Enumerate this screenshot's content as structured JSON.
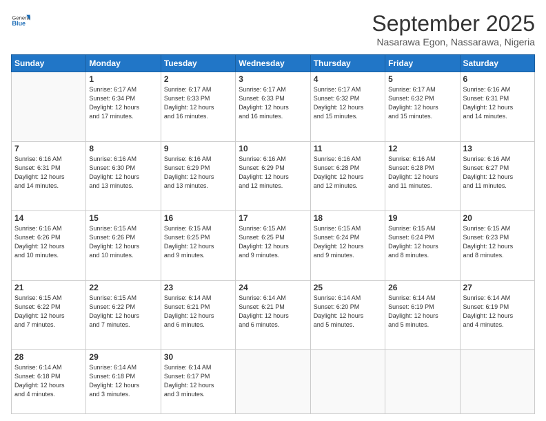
{
  "header": {
    "logo_general": "General",
    "logo_blue": "Blue",
    "month_title": "September 2025",
    "subtitle": "Nasarawa Egon, Nassarawa, Nigeria"
  },
  "days_of_week": [
    "Sunday",
    "Monday",
    "Tuesday",
    "Wednesday",
    "Thursday",
    "Friday",
    "Saturday"
  ],
  "weeks": [
    [
      {
        "day": "",
        "info": ""
      },
      {
        "day": "1",
        "info": "Sunrise: 6:17 AM\nSunset: 6:34 PM\nDaylight: 12 hours\nand 17 minutes."
      },
      {
        "day": "2",
        "info": "Sunrise: 6:17 AM\nSunset: 6:33 PM\nDaylight: 12 hours\nand 16 minutes."
      },
      {
        "day": "3",
        "info": "Sunrise: 6:17 AM\nSunset: 6:33 PM\nDaylight: 12 hours\nand 16 minutes."
      },
      {
        "day": "4",
        "info": "Sunrise: 6:17 AM\nSunset: 6:32 PM\nDaylight: 12 hours\nand 15 minutes."
      },
      {
        "day": "5",
        "info": "Sunrise: 6:17 AM\nSunset: 6:32 PM\nDaylight: 12 hours\nand 15 minutes."
      },
      {
        "day": "6",
        "info": "Sunrise: 6:16 AM\nSunset: 6:31 PM\nDaylight: 12 hours\nand 14 minutes."
      }
    ],
    [
      {
        "day": "7",
        "info": "Sunrise: 6:16 AM\nSunset: 6:31 PM\nDaylight: 12 hours\nand 14 minutes."
      },
      {
        "day": "8",
        "info": "Sunrise: 6:16 AM\nSunset: 6:30 PM\nDaylight: 12 hours\nand 13 minutes."
      },
      {
        "day": "9",
        "info": "Sunrise: 6:16 AM\nSunset: 6:29 PM\nDaylight: 12 hours\nand 13 minutes."
      },
      {
        "day": "10",
        "info": "Sunrise: 6:16 AM\nSunset: 6:29 PM\nDaylight: 12 hours\nand 12 minutes."
      },
      {
        "day": "11",
        "info": "Sunrise: 6:16 AM\nSunset: 6:28 PM\nDaylight: 12 hours\nand 12 minutes."
      },
      {
        "day": "12",
        "info": "Sunrise: 6:16 AM\nSunset: 6:28 PM\nDaylight: 12 hours\nand 11 minutes."
      },
      {
        "day": "13",
        "info": "Sunrise: 6:16 AM\nSunset: 6:27 PM\nDaylight: 12 hours\nand 11 minutes."
      }
    ],
    [
      {
        "day": "14",
        "info": "Sunrise: 6:16 AM\nSunset: 6:26 PM\nDaylight: 12 hours\nand 10 minutes."
      },
      {
        "day": "15",
        "info": "Sunrise: 6:15 AM\nSunset: 6:26 PM\nDaylight: 12 hours\nand 10 minutes."
      },
      {
        "day": "16",
        "info": "Sunrise: 6:15 AM\nSunset: 6:25 PM\nDaylight: 12 hours\nand 9 minutes."
      },
      {
        "day": "17",
        "info": "Sunrise: 6:15 AM\nSunset: 6:25 PM\nDaylight: 12 hours\nand 9 minutes."
      },
      {
        "day": "18",
        "info": "Sunrise: 6:15 AM\nSunset: 6:24 PM\nDaylight: 12 hours\nand 9 minutes."
      },
      {
        "day": "19",
        "info": "Sunrise: 6:15 AM\nSunset: 6:24 PM\nDaylight: 12 hours\nand 8 minutes."
      },
      {
        "day": "20",
        "info": "Sunrise: 6:15 AM\nSunset: 6:23 PM\nDaylight: 12 hours\nand 8 minutes."
      }
    ],
    [
      {
        "day": "21",
        "info": "Sunrise: 6:15 AM\nSunset: 6:22 PM\nDaylight: 12 hours\nand 7 minutes."
      },
      {
        "day": "22",
        "info": "Sunrise: 6:15 AM\nSunset: 6:22 PM\nDaylight: 12 hours\nand 7 minutes."
      },
      {
        "day": "23",
        "info": "Sunrise: 6:14 AM\nSunset: 6:21 PM\nDaylight: 12 hours\nand 6 minutes."
      },
      {
        "day": "24",
        "info": "Sunrise: 6:14 AM\nSunset: 6:21 PM\nDaylight: 12 hours\nand 6 minutes."
      },
      {
        "day": "25",
        "info": "Sunrise: 6:14 AM\nSunset: 6:20 PM\nDaylight: 12 hours\nand 5 minutes."
      },
      {
        "day": "26",
        "info": "Sunrise: 6:14 AM\nSunset: 6:19 PM\nDaylight: 12 hours\nand 5 minutes."
      },
      {
        "day": "27",
        "info": "Sunrise: 6:14 AM\nSunset: 6:19 PM\nDaylight: 12 hours\nand 4 minutes."
      }
    ],
    [
      {
        "day": "28",
        "info": "Sunrise: 6:14 AM\nSunset: 6:18 PM\nDaylight: 12 hours\nand 4 minutes."
      },
      {
        "day": "29",
        "info": "Sunrise: 6:14 AM\nSunset: 6:18 PM\nDaylight: 12 hours\nand 3 minutes."
      },
      {
        "day": "30",
        "info": "Sunrise: 6:14 AM\nSunset: 6:17 PM\nDaylight: 12 hours\nand 3 minutes."
      },
      {
        "day": "",
        "info": ""
      },
      {
        "day": "",
        "info": ""
      },
      {
        "day": "",
        "info": ""
      },
      {
        "day": "",
        "info": ""
      }
    ]
  ]
}
